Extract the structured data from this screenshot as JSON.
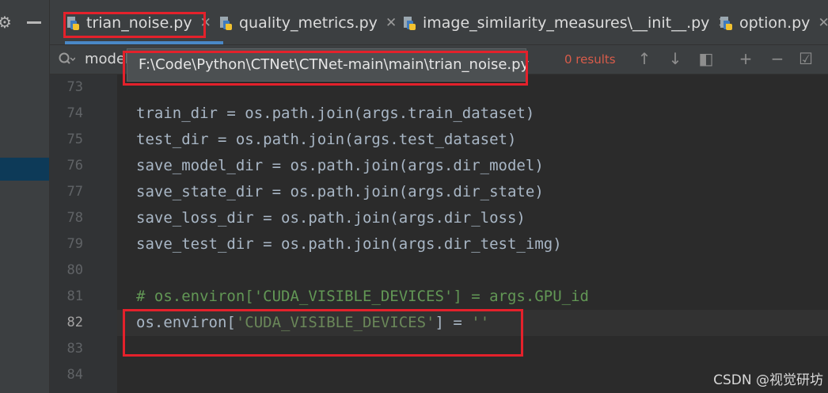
{
  "tabs": [
    {
      "label": "trian_noise.py",
      "icon": "python-file-icon",
      "active": true
    },
    {
      "label": "quality_metrics.py",
      "icon": "python-file-icon"
    },
    {
      "label": "image_similarity_measures\\__init__.py",
      "icon": "python-file-icon"
    },
    {
      "label": "option.py",
      "icon": "python-file-icon"
    }
  ],
  "close_glyph": "✕",
  "find": {
    "value": "model",
    "results": "0 results"
  },
  "tooltip": {
    "path": "F:\\Code\\Python\\CTNet\\CTNet-main\\main\\trian_noise.py"
  },
  "editor": {
    "lines": [
      {
        "n": "73",
        "code": ""
      },
      {
        "n": "74",
        "code": "train_dir = os.path.join(args.train_dataset)"
      },
      {
        "n": "75",
        "code": "test_dir = os.path.join(args.test_dataset)"
      },
      {
        "n": "76",
        "code": "save_model_dir = os.path.join(args.dir_model)"
      },
      {
        "n": "77",
        "code": "save_state_dir = os.path.join(args.dir_state)"
      },
      {
        "n": "78",
        "code": "save_loss_dir = os.path.join(args.dir_loss)"
      },
      {
        "n": "79",
        "code": "save_test_dir = os.path.join(args.dir_test_img)"
      },
      {
        "n": "80",
        "code": ""
      },
      {
        "n": "81",
        "code": "# os.environ['CUDA_VISIBLE_DEVICES'] = args.GPU_id",
        "type": "comment"
      },
      {
        "n": "82",
        "code_pre": "os.environ[",
        "code_str": "'CUDA_VISIBLE_DEVICES'",
        "code_mid": "] = ",
        "code_str2": "''",
        "current": true
      },
      {
        "n": "83",
        "code": ""
      },
      {
        "n": "84",
        "code": ""
      }
    ]
  },
  "watermark": "CSDN @视觉研坊",
  "colors": {
    "background": "#2b2b2b",
    "panel": "#3c3f41",
    "comment": "#629755",
    "string": "#6a8759",
    "highlight_box": "#e4212b",
    "results_text": "#d95c4a"
  }
}
